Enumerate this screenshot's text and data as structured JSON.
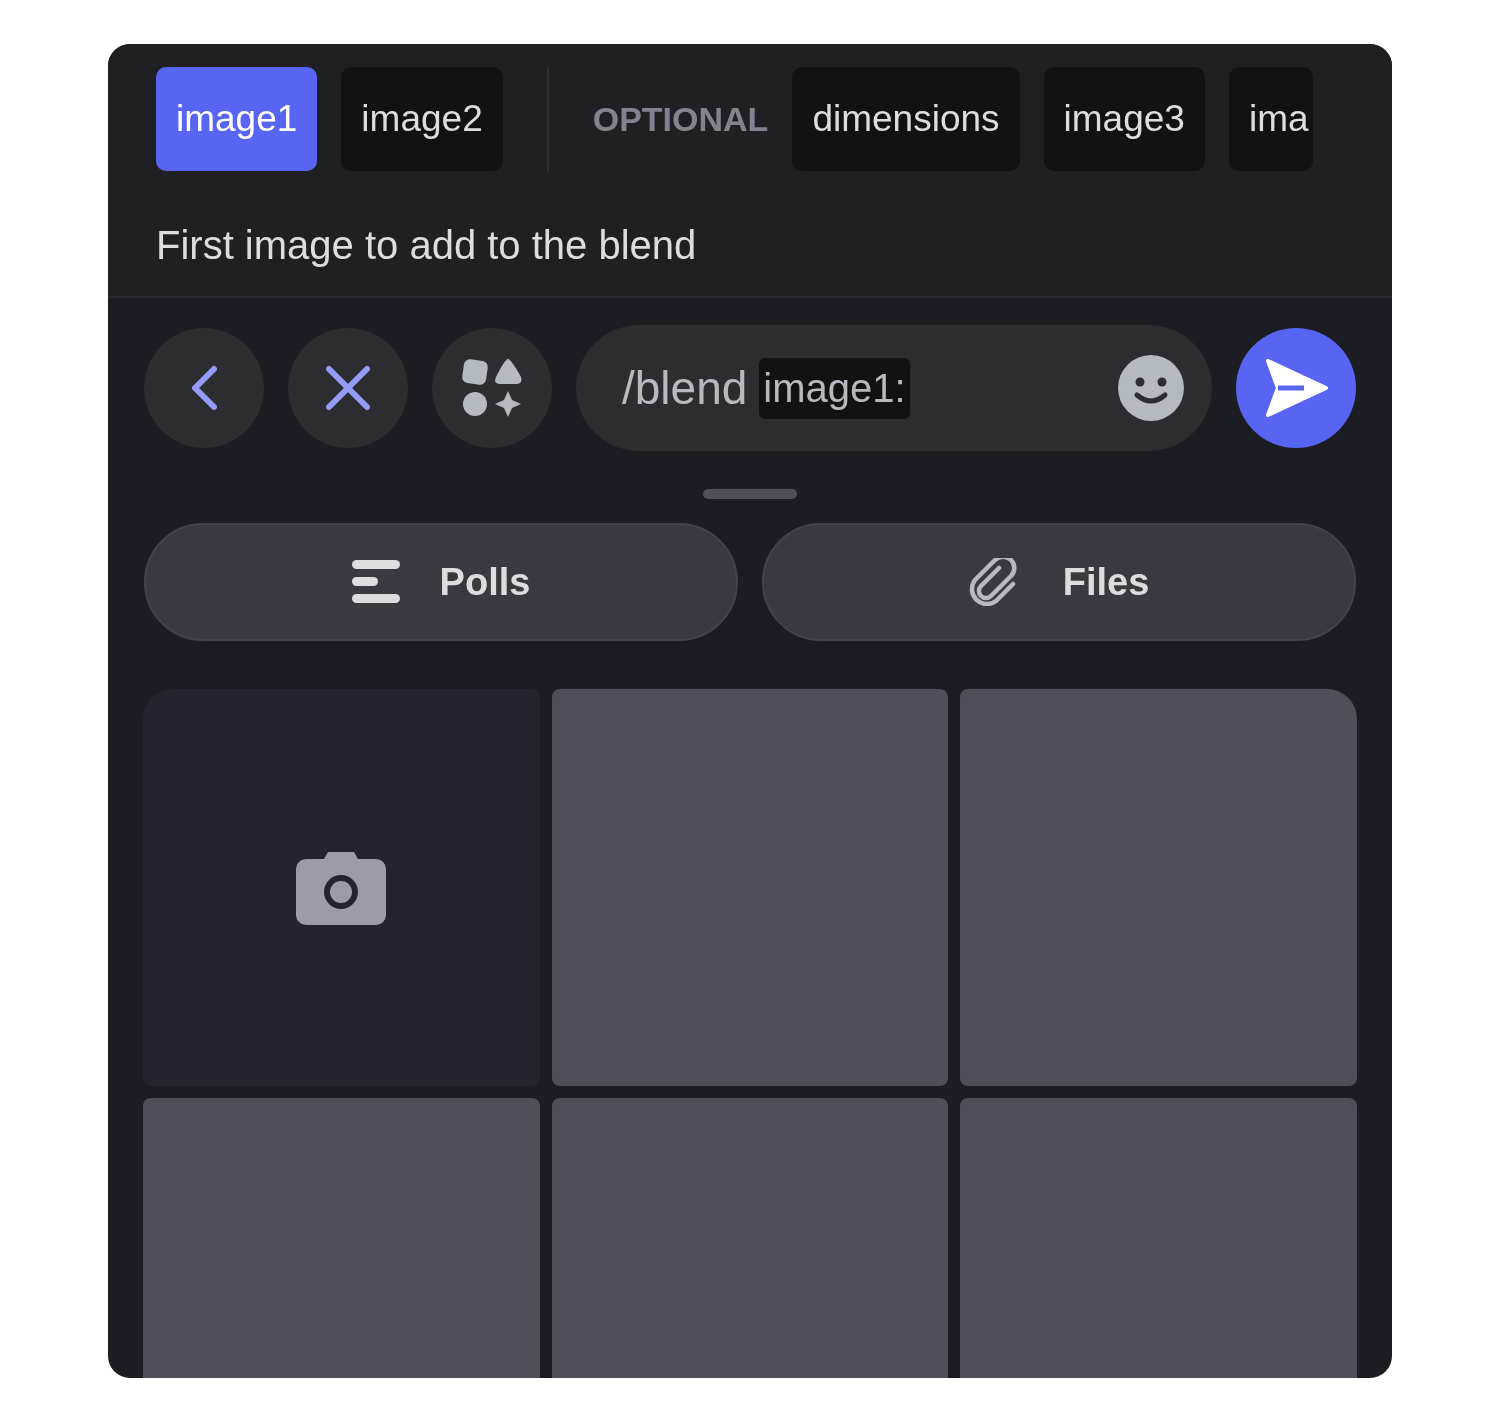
{
  "tabs": [
    {
      "kind": "tab",
      "label": "image1",
      "selected": true
    },
    {
      "kind": "tab",
      "label": "image2",
      "selected": false
    },
    {
      "kind": "divider"
    },
    {
      "kind": "label",
      "label": "OPTIONAL"
    },
    {
      "kind": "tab",
      "label": "dimensions",
      "selected": false
    },
    {
      "kind": "tab",
      "label": "image3",
      "selected": false
    },
    {
      "kind": "tab",
      "label": "ima",
      "selected": false
    }
  ],
  "description": "First image to add to the blend",
  "composer": {
    "command": "/blend",
    "option": "image1:"
  },
  "attachments": [
    {
      "kind": "polls",
      "label": "Polls"
    },
    {
      "kind": "files",
      "label": "Files"
    }
  ],
  "gallery": [
    {
      "kind": "camera"
    },
    {
      "kind": "empty"
    },
    {
      "kind": "empty"
    },
    {
      "kind": "empty"
    },
    {
      "kind": "empty"
    },
    {
      "kind": "empty"
    }
  ]
}
